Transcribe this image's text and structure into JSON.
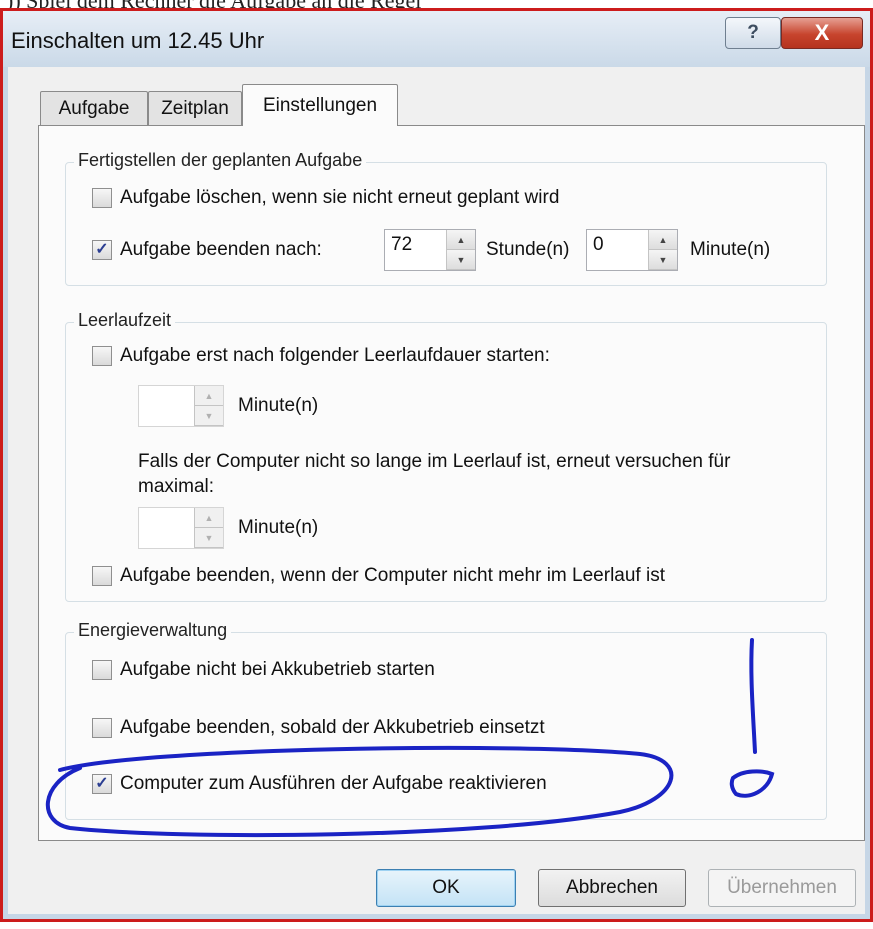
{
  "page_top_text": ")) Spiel dem Rechner die Aufgabe an die Regel",
  "window": {
    "title": "Einschalten um 12.45 Uhr",
    "help_label": "?",
    "close_label": "X"
  },
  "tabs": [
    {
      "label": "Aufgabe",
      "active": false
    },
    {
      "label": "Zeitplan",
      "active": false
    },
    {
      "label": "Einstellungen",
      "active": true
    }
  ],
  "fertigstellen": {
    "legend": "Fertigstellen der geplanten Aufgabe",
    "delete_task": {
      "label": "Aufgabe löschen, wenn sie nicht erneut geplant wird",
      "checked": false
    },
    "stop_after": {
      "label": "Aufgabe beenden nach:",
      "checked": true
    },
    "hours_value": "72",
    "hours_label": "Stunde(n)",
    "minutes_value": "0",
    "minutes_label": "Minute(n)"
  },
  "leerlauf": {
    "legend": "Leerlaufzeit",
    "start_after_idle": {
      "label": "Aufgabe erst nach folgender Leerlaufdauer starten:",
      "checked": false
    },
    "idle_minutes_value": "",
    "idle_minutes_label": "Minute(n)",
    "retry_text": "Falls der Computer nicht so lange im Leerlauf ist, erneut versuchen für maximal:",
    "retry_minutes_value": "",
    "retry_minutes_label": "Minute(n)",
    "stop_when_not_idle": {
      "label": "Aufgabe beenden, wenn der Computer nicht mehr im Leerlauf ist",
      "checked": false
    }
  },
  "energie": {
    "legend": "Energieverwaltung",
    "no_battery_start": {
      "label": "Aufgabe nicht bei Akkubetrieb starten",
      "checked": false
    },
    "stop_on_battery": {
      "label": "Aufgabe beenden, sobald der Akkubetrieb einsetzt",
      "checked": false
    },
    "wake_computer": {
      "label": "Computer zum Ausführen der Aufgabe reaktivieren",
      "checked": true
    }
  },
  "buttons": {
    "ok": "OK",
    "cancel": "Abbrechen",
    "apply": "Übernehmen"
  },
  "colors": {
    "frame_red": "#cc1c1c",
    "annotation_blue": "#1a23c4",
    "check_blue": "#2b3e92"
  }
}
